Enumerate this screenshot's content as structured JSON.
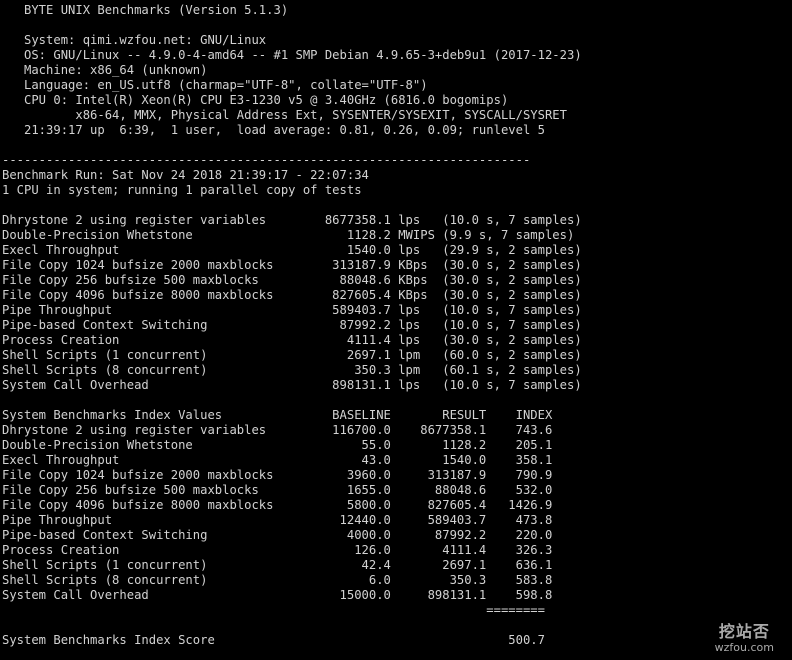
{
  "header": {
    "title_line": "   BYTE UNIX Benchmarks (Version 5.1.3)",
    "system_line": "   System: qimi.wzfou.net: GNU/Linux",
    "os_line": "   OS: GNU/Linux -- 4.9.0-4-amd64 -- #1 SMP Debian 4.9.65-3+deb9u1 (2017-12-23)",
    "machine_line": "   Machine: x86_64 (unknown)",
    "language_line": "   Language: en_US.utf8 (charmap=\"UTF-8\", collate=\"UTF-8\")",
    "cpu_line": "   CPU 0: Intel(R) Xeon(R) CPU E3-1230 v5 @ 3.40GHz (6816.0 bogomips)",
    "cpu_flags_line": "          x86-64, MMX, Physical Address Ext, SYSENTER/SYSEXIT, SYSCALL/SYSRET",
    "uptime_line": "   21:39:17 up  6:39,  1 user,  load average: 0.81, 0.26, 0.09; runlevel 5"
  },
  "run": {
    "separator_line": "------------------------------------------------------------------------",
    "run_line": "Benchmark Run: Sat Nov 24 2018 21:39:17 - 22:07:34",
    "cpu_count_line": "1 CPU in system; running 1 parallel copy of tests"
  },
  "results": [
    "Dhrystone 2 using register variables        8677358.1 lps   (10.0 s, 7 samples)",
    "Double-Precision Whetstone                     1128.2 MWIPS (9.9 s, 7 samples)",
    "Execl Throughput                               1540.0 lps   (29.9 s, 2 samples)",
    "File Copy 1024 bufsize 2000 maxblocks        313187.9 KBps  (30.0 s, 2 samples)",
    "File Copy 256 bufsize 500 maxblocks           88048.6 KBps  (30.0 s, 2 samples)",
    "File Copy 4096 bufsize 8000 maxblocks        827605.4 KBps  (30.0 s, 2 samples)",
    "Pipe Throughput                              589403.7 lps   (10.0 s, 7 samples)",
    "Pipe-based Context Switching                  87992.2 lps   (10.0 s, 7 samples)",
    "Process Creation                               4111.4 lps   (30.0 s, 2 samples)",
    "Shell Scripts (1 concurrent)                   2697.1 lpm   (60.0 s, 2 samples)",
    "Shell Scripts (8 concurrent)                    350.3 lpm   (60.1 s, 2 samples)",
    "System Call Overhead                         898131.1 lps   (10.0 s, 7 samples)"
  ],
  "index": {
    "header_line": "System Benchmarks Index Values               BASELINE       RESULT    INDEX",
    "rows": [
      "Dhrystone 2 using register variables         116700.0    8677358.1    743.6",
      "Double-Precision Whetstone                       55.0       1128.2    205.1",
      "Execl Throughput                                 43.0       1540.0    358.1",
      "File Copy 1024 bufsize 2000 maxblocks          3960.0     313187.9    790.9",
      "File Copy 256 bufsize 500 maxblocks            1655.0      88048.6    532.0",
      "File Copy 4096 bufsize 8000 maxblocks          5800.0     827605.4   1426.9",
      "Pipe Throughput                               12440.0     589403.7    473.8",
      "Pipe-based Context Switching                   4000.0      87992.2    220.0",
      "Process Creation                                126.0       4111.4    326.3",
      "Shell Scripts (1 concurrent)                     42.4       2697.1    636.1",
      "Shell Scripts (8 concurrent)                      6.0        350.3    583.8",
      "System Call Overhead                          15000.0     898131.1    598.8"
    ],
    "rule_line": "                                                                  ========",
    "score_line": "System Benchmarks Index Score                                        500.7"
  },
  "watermark": {
    "cn": "挖站否",
    "url": "wzfou.com"
  }
}
